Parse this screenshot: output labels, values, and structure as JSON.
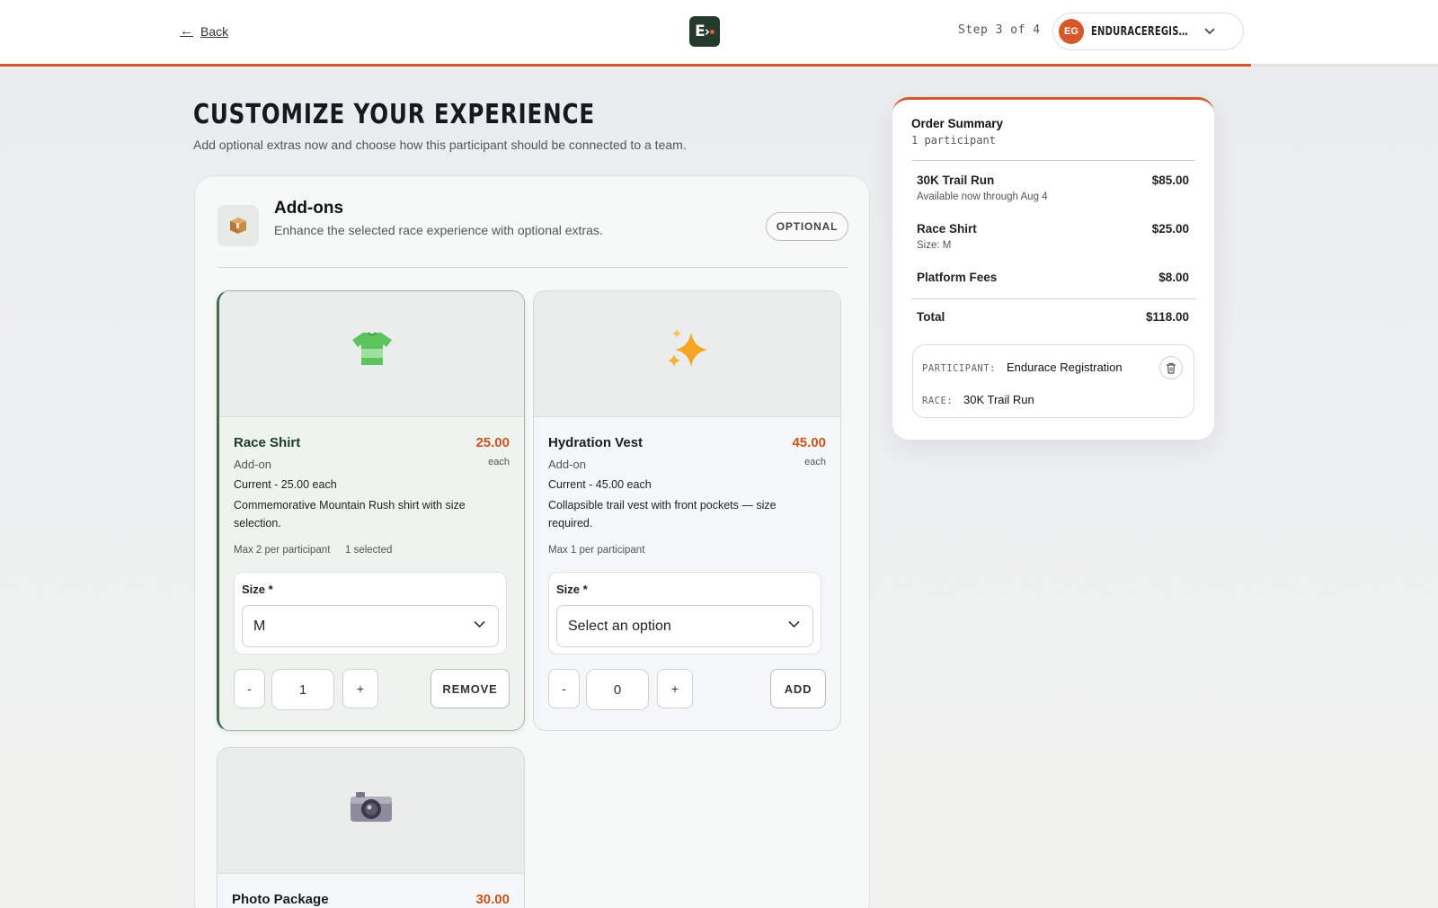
{
  "header": {
    "back_label": "Back",
    "logo_text": "E",
    "step_text": "Step 3 of 4",
    "progress_fraction": 0.87,
    "account": {
      "initials": "EG",
      "name": "ENDURACEREGISTRAT..."
    }
  },
  "page": {
    "title": "CUSTOMIZE YOUR EXPERIENCE",
    "subtitle": "Add optional extras now and choose how this participant should be connected to a team."
  },
  "addons": {
    "title": "Add-ons",
    "subtitle": "Enhance the selected race experience with optional extras.",
    "badge": "OPTIONAL",
    "icon": "package-icon",
    "items": [
      {
        "name": "Race Shirt",
        "price": "25.00",
        "type": "Add-on",
        "unit": "each",
        "current": "Current - 25.00 each",
        "description": "Commemorative Mountain Rush shirt with size selection.",
        "max": "Max 2 per participant",
        "selected_count": "1 selected",
        "size_label": "Size *",
        "size_value": "M",
        "qty_minus": "-",
        "quantity": "1",
        "qty_plus": "+",
        "action": "REMOVE",
        "icon": "tshirt-icon"
      },
      {
        "name": "Hydration Vest",
        "price": "45.00",
        "type": "Add-on",
        "unit": "each",
        "current": "Current - 45.00 each",
        "description": "Collapsible trail vest with front pockets — size required.",
        "max": "Max 1 per participant",
        "size_label": "Size *",
        "size_value": "Select an option",
        "qty_minus": "-",
        "quantity": "0",
        "qty_plus": "+",
        "action": "ADD",
        "icon": "sparkles-icon"
      },
      {
        "name": "Photo Package",
        "price": "30.00",
        "icon": "camera-icon"
      }
    ]
  },
  "summary": {
    "title": "Order Summary",
    "subtitle": "1 participant",
    "rows": [
      {
        "name": "30K Trail Run",
        "sub": "Available now through Aug 4",
        "price": "$85.00"
      },
      {
        "name": "Race Shirt",
        "sub": "Size: M",
        "price": "$25.00"
      },
      {
        "name": "Platform Fees",
        "price": "$8.00"
      }
    ],
    "total_label": "Total",
    "total_value": "$118.00",
    "participant_key": "PARTICIPANT:",
    "participant_value": "Endurace Registration",
    "race_key": "RACE:",
    "race_value": "30K Trail Run"
  },
  "colors": {
    "accent": "#d4582a",
    "brand_dark": "#243a2c",
    "selected_border": "#3f6b4c"
  }
}
